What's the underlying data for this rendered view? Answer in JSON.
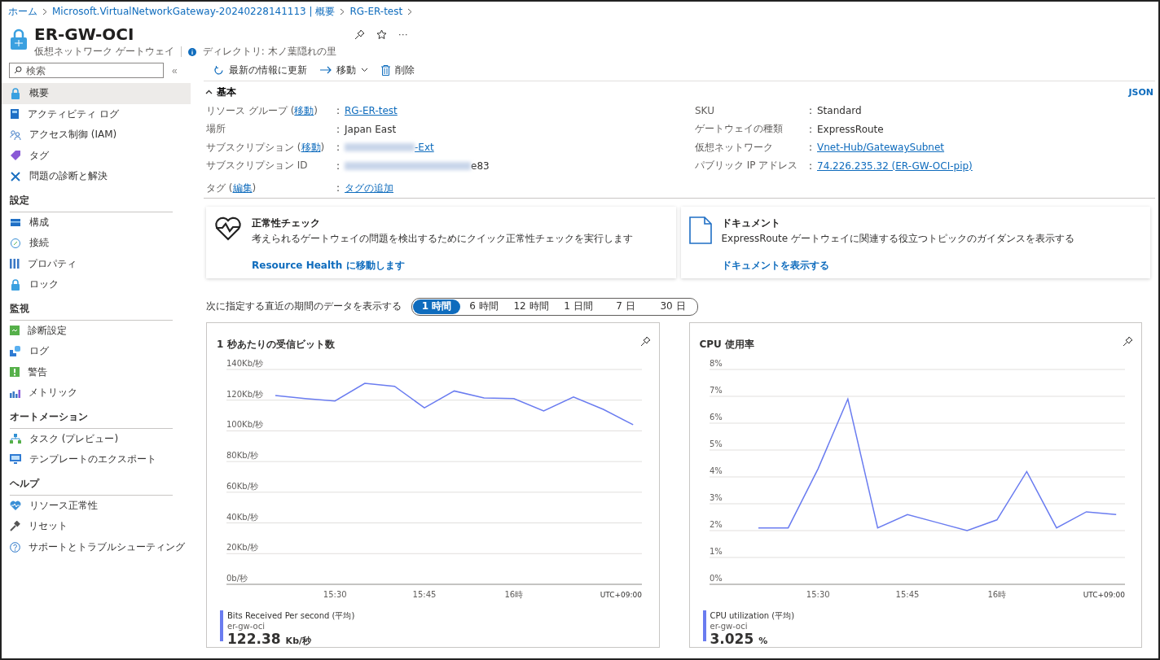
{
  "breadcrumb": [
    "ホーム",
    "Microsoft.VirtualNetworkGateway-20240228141113 | 概要",
    "RG-ER-test"
  ],
  "header": {
    "title": "ER-GW-OCI",
    "subtitle": "仮想ネットワーク ゲートウェイ",
    "more": "···",
    "directory": "ディレクトリ: 木ノ葉隠れの里"
  },
  "sidebar": {
    "search": {
      "placeholder": "検索"
    },
    "collapse": "«",
    "sections": [
      {
        "items": [
          {
            "label": "概要",
            "selected": true
          },
          {
            "label": "アクティビティ ログ",
            "selected": false
          },
          {
            "label": "アクセス制御 (IAM)",
            "selected": false
          },
          {
            "label": "タグ",
            "selected": false
          },
          {
            "label": "問題の診断と解決",
            "selected": false
          }
        ]
      },
      {
        "title": "設定",
        "items": [
          {
            "label": "構成",
            "selected": false
          },
          {
            "label": "接続",
            "selected": false
          },
          {
            "label": "プロパティ",
            "selected": false
          },
          {
            "label": "ロック",
            "selected": false
          }
        ]
      },
      {
        "title": "監視",
        "items": [
          {
            "label": "診断設定",
            "selected": false
          },
          {
            "label": "ログ",
            "selected": false
          },
          {
            "label": "警告",
            "selected": false
          },
          {
            "label": "メトリック",
            "selected": false
          }
        ]
      },
      {
        "title": "オートメーション",
        "items": [
          {
            "label": "タスク (プレビュー)",
            "selected": false
          },
          {
            "label": "テンプレートのエクスポート",
            "selected": false
          }
        ]
      },
      {
        "title": "ヘルプ",
        "items": [
          {
            "label": "リソース正常性",
            "selected": false
          },
          {
            "label": "リセット",
            "selected": false
          },
          {
            "label": "サポートとトラブルシューティング",
            "selected": false
          }
        ]
      }
    ]
  },
  "toolbar": [
    {
      "label": "最新の情報に更新",
      "kind": "refresh"
    },
    {
      "label": "移動",
      "kind": "move"
    },
    {
      "label": "削除",
      "kind": "delete"
    }
  ],
  "essentials": {
    "title": "基本",
    "expanded": true,
    "json_link": "JSON",
    "left": [
      {
        "label": "リソース グループ (",
        "label_link": "移動",
        "label_after": ")",
        "colon": ":",
        "value": "RG-ER-test",
        "value_link": true
      },
      {
        "label": "場所",
        "colon": ":",
        "value": "Japan East",
        "value_link": false
      },
      {
        "label": "サブスクリプション (",
        "label_link": "移動",
        "label_after": ")",
        "colon": ":",
        "value": "-Ext",
        "value_link": true,
        "redacted": true
      },
      {
        "label": "サブスクリプション ID",
        "colon": ":",
        "value": "e83",
        "value_link": false,
        "redacted": true
      },
      {
        "label": "タグ (",
        "label_link": "編集",
        "label_after": ")",
        "colon": ":",
        "value": "タグの追加",
        "value_link": true
      }
    ],
    "right": [
      {
        "label": "SKU",
        "colon": ":",
        "value": "Standard",
        "value_link": false
      },
      {
        "label": "ゲートウェイの種類",
        "colon": ":",
        "value": "ExpressRoute",
        "value_link": false
      },
      {
        "label": "仮想ネットワーク",
        "colon": ":",
        "value": "Vnet-Hub/GatewaySubnet",
        "value_link": true
      },
      {
        "label": "パブリック IP アドレス",
        "colon": ":",
        "value": "74.226.235.32 (ER-GW-OCI-pip)",
        "value_link": true
      }
    ]
  },
  "cards": [
    {
      "kind": "health",
      "title": "正常性チェック",
      "description": "考えられるゲートウェイの問題を検出するためにクイック正常性チェックを実行します",
      "link": "Resource Health に移動します"
    },
    {
      "kind": "docs",
      "title": "ドキュメント",
      "description": "ExpressRoute ゲートウェイに関連する役立つトピックのガイダンスを表示する",
      "link": "ドキュメントを表示する"
    }
  ],
  "time_range": {
    "label": "次に指定する直近の期間のデータを表示する",
    "options": [
      {
        "label": "1 時間",
        "selected": true
      },
      {
        "label": "6 時間",
        "selected": false
      },
      {
        "label": "12 時間",
        "selected": false
      },
      {
        "label": "1 日間",
        "selected": false
      },
      {
        "label": "7 日",
        "selected": false
      },
      {
        "label": "30 日",
        "selected": false
      }
    ]
  },
  "charts": [
    {
      "title": "1 秒あたりの受信ビット数",
      "timezone": "UTC+09:00",
      "legend": {
        "resource": "er-gw-oci",
        "value": "122.38",
        "unit": "Kb/秒"
      },
      "chart_data": {
        "type": "line",
        "categories": [
          null,
          null,
          "15:30",
          null,
          null,
          "15:45",
          null,
          null,
          "16時",
          null,
          null,
          null,
          null
        ],
        "ylim": [
          0,
          140
        ],
        "grid": true,
        "yticks": [
          {
            "value": 0,
            "label": "0b/秒"
          },
          {
            "value": 20,
            "label": "20Kb/秒"
          },
          {
            "value": 40,
            "label": "40Kb/秒"
          },
          {
            "value": 60,
            "label": "60Kb/秒"
          },
          {
            "value": 80,
            "label": "80Kb/秒"
          },
          {
            "value": 100,
            "label": "100Kb/秒"
          },
          {
            "value": 120,
            "label": "120Kb/秒"
          },
          {
            "value": 140,
            "label": "140Kb/秒"
          }
        ],
        "series": [
          {
            "name": "Bits Received Per second (平均)",
            "color": "#6a7cf0",
            "values": [
              123,
              121,
              119.5,
              131,
              129,
              115,
              126,
              121.5,
              121,
              113,
              122,
              114,
              104
            ]
          }
        ]
      }
    },
    {
      "title": "CPU 使用率",
      "timezone": "UTC+09:00",
      "legend": {
        "resource": "er-gw-oci",
        "value": "3.025",
        "unit": "%"
      },
      "chart_data": {
        "type": "line",
        "categories": [
          null,
          null,
          "15:30",
          null,
          null,
          "15:45",
          null,
          null,
          "16時",
          null,
          null,
          null,
          null
        ],
        "ylim": [
          0,
          8
        ],
        "grid": true,
        "yticks": [
          {
            "value": 0,
            "label": "0%"
          },
          {
            "value": 1,
            "label": "1%"
          },
          {
            "value": 2,
            "label": "2%"
          },
          {
            "value": 3,
            "label": "3%"
          },
          {
            "value": 4,
            "label": "4%"
          },
          {
            "value": 5,
            "label": "5%"
          },
          {
            "value": 6,
            "label": "6%"
          },
          {
            "value": 7,
            "label": "7%"
          },
          {
            "value": 8,
            "label": "8%"
          }
        ],
        "series": [
          {
            "name": "CPU utilization (平均)",
            "color": "#6a7cf0",
            "values": [
              2.1,
              2.1,
              4.3,
              6.9,
              2.1,
              2.6,
              2.3,
              2.0,
              2.4,
              4.2,
              2.1,
              2.7,
              2.6
            ]
          }
        ]
      }
    }
  ]
}
